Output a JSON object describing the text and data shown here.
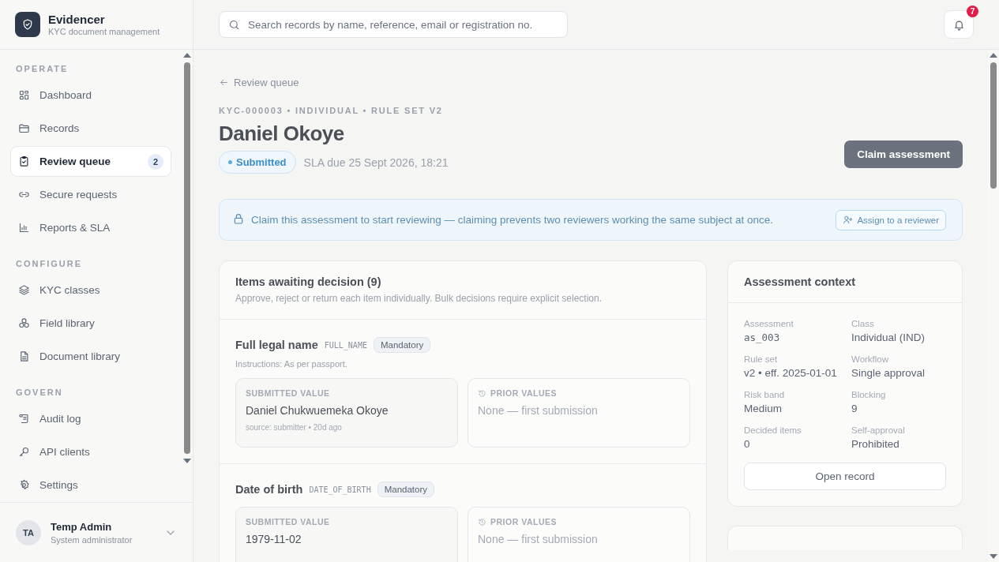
{
  "brand": {
    "name": "Evidencer",
    "subtitle": "KYC document management"
  },
  "sidebar": {
    "sections": [
      {
        "title": "OPERATE",
        "items": [
          {
            "label": "Dashboard",
            "selected": false
          },
          {
            "label": "Records",
            "selected": false
          },
          {
            "label": "Review queue",
            "selected": true,
            "badge": "2"
          },
          {
            "label": "Secure requests",
            "selected": false
          },
          {
            "label": "Reports & SLA",
            "selected": false
          }
        ]
      },
      {
        "title": "CONFIGURE",
        "items": [
          {
            "label": "KYC classes",
            "selected": false
          },
          {
            "label": "Field library",
            "selected": false
          },
          {
            "label": "Document library",
            "selected": false
          }
        ]
      },
      {
        "title": "GOVERN",
        "items": [
          {
            "label": "Audit log",
            "selected": false
          },
          {
            "label": "API clients",
            "selected": false
          },
          {
            "label": "Settings",
            "selected": false
          }
        ]
      }
    ]
  },
  "user": {
    "initials": "TA",
    "name": "Temp Admin",
    "role": "System administrator"
  },
  "header": {
    "search": {
      "placeholder": "Search records by name, reference, email or registration no."
    },
    "notifications": "7"
  },
  "back_link": "Review queue",
  "meta": "KYC-000003 • INDIVIDUAL • RULE SET V2",
  "title": "Daniel Okoye",
  "status": "Submitted",
  "sla": "SLA due 25 Sept 2026, 18:21",
  "claim_button": "Claim assessment",
  "banner": {
    "text": "Claim this assessment to start reviewing — claiming prevents two reviewers working the same subject at once.",
    "button": "Assign to a reviewer"
  },
  "items_panel": {
    "title": "Items awaiting decision (9)",
    "subtitle": "Approve, reject or return each item individually. Bulk decisions require explicit selection.",
    "items": [
      {
        "name": "Full legal name",
        "code": "FULL_NAME",
        "tag": "Mandatory",
        "instructions": "Instructions: As per passport.",
        "submitted_label": "SUBMITTED VALUE",
        "value": "Daniel Chukwuemeka Okoye",
        "source": "source: submitter • 20d ago",
        "prior_label": "PRIOR VALUES",
        "prior": "None — first submission"
      },
      {
        "name": "Date of birth",
        "code": "DATE_OF_BIRTH",
        "tag": "Mandatory",
        "submitted_label": "SUBMITTED VALUE",
        "value": "1979-11-02",
        "prior_label": "PRIOR VALUES",
        "prior": "None — first submission"
      }
    ]
  },
  "context": {
    "title": "Assessment context",
    "fields": [
      {
        "label": "Assessment",
        "value": "as_003",
        "kind": "mono"
      },
      {
        "label": "Class",
        "value": "Individual (IND)",
        "kind": "text"
      },
      {
        "label": "Rule set",
        "value": "v2 • eff. 2025-01-01",
        "kind": "text"
      },
      {
        "label": "Workflow",
        "value": "Single approval",
        "kind": "text"
      },
      {
        "label": "Risk band",
        "value": "Medium",
        "kind": "text"
      },
      {
        "label": "Blocking",
        "value": "9",
        "kind": "text"
      },
      {
        "label": "Decided items",
        "value": "0",
        "kind": "text"
      },
      {
        "label": "Self-approval",
        "value": "Prohibited",
        "kind": "text"
      }
    ],
    "button": "Open record"
  }
}
